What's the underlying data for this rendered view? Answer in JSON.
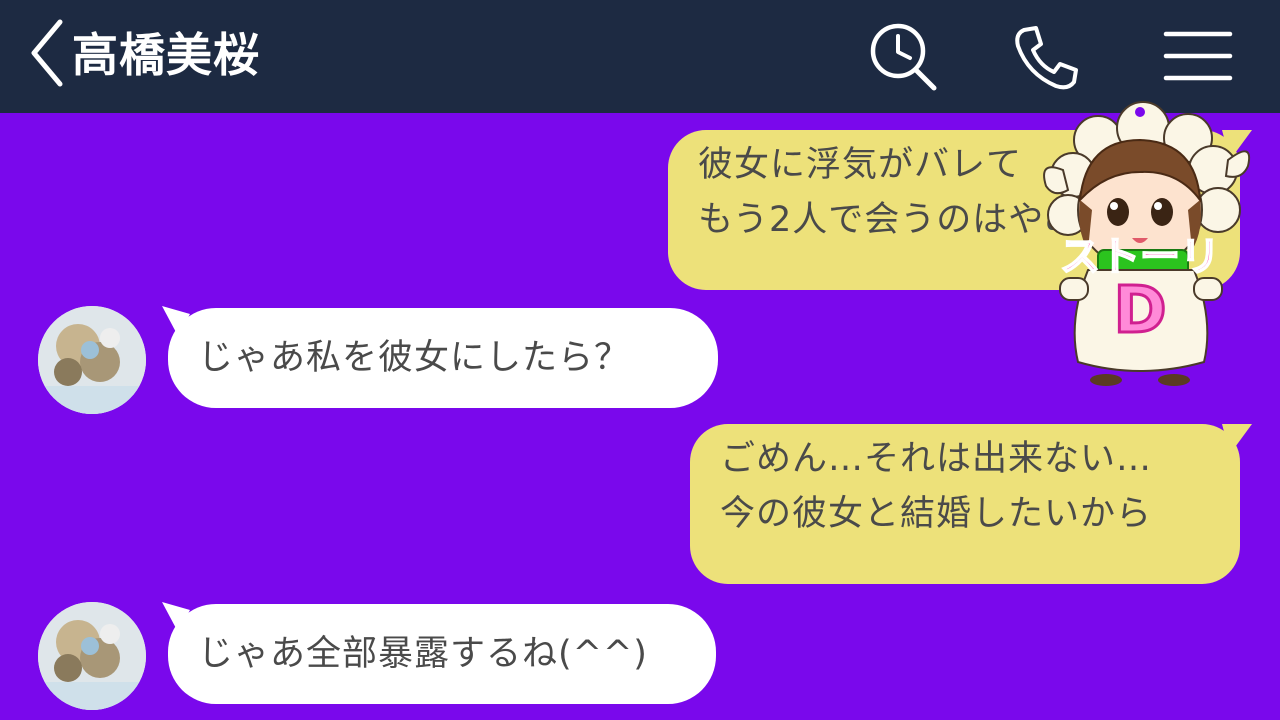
{
  "header": {
    "title": "高橋美桜",
    "back_icon": "chevron-left-icon",
    "search_icon": "search-history-icon",
    "phone_icon": "phone-icon",
    "menu_icon": "hamburger-menu-icon"
  },
  "messages": [
    {
      "side": "outgoing",
      "lines": [
        "彼女に浮気がバレて",
        "もう2人で会うのはやめよう"
      ]
    },
    {
      "side": "incoming",
      "avatar": "avatar-image",
      "lines": [
        "じゃあ私を彼女にしたら？"
      ]
    },
    {
      "side": "outgoing",
      "lines": [
        "ごめん…それは出来ない…",
        "今の彼女と結婚したいから"
      ]
    },
    {
      "side": "incoming",
      "avatar": "avatar-image",
      "lines": [
        "じゃあ全部暴露するね(^^)"
      ]
    }
  ],
  "watermark": {
    "text": "ストーリ",
    "letter": "D"
  },
  "colors": {
    "header_bg": "#1d2a42",
    "chat_bg": "#7a08ec",
    "outgoing_bubble": "#ede17a",
    "incoming_bubble": "#ffffff",
    "text": "#4a4a4a",
    "watermark_accent": "#ff1493"
  }
}
